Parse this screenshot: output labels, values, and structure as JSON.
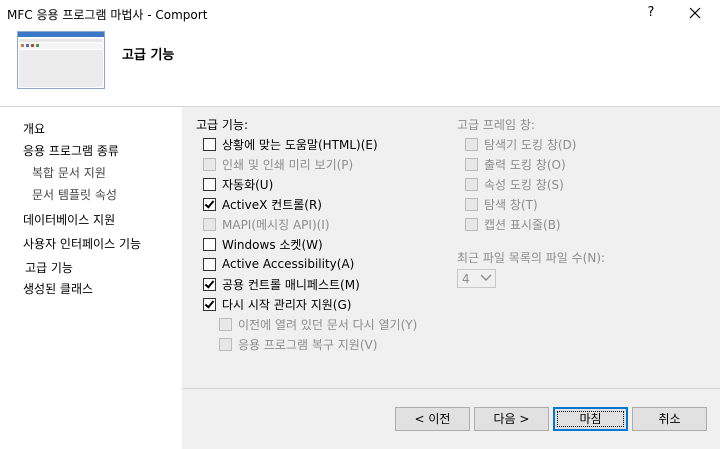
{
  "window": {
    "title": "MFC 응용 프로그램 마법사 - Comport",
    "help_glyph": "?"
  },
  "header": {
    "page_title": "고급 기능"
  },
  "nav": {
    "items": [
      {
        "label": "개요"
      },
      {
        "label": "응용 프로그램 종류"
      },
      {
        "label": "복합 문서 지원"
      },
      {
        "label": "문서 템플릿 속성"
      },
      {
        "label": "데이터베이스 지원"
      },
      {
        "label": "사용자 인터페이스 기능"
      },
      {
        "label": "고급 기능"
      },
      {
        "label": "생성된 클래스"
      }
    ]
  },
  "advanced": {
    "label": "고급 기능:",
    "options": [
      {
        "label": "상황에 맞는 도움말(HTML)(E)",
        "checked": false,
        "enabled": true
      },
      {
        "label": "인쇄 및 인쇄 미리 보기(P)",
        "checked": false,
        "enabled": false
      },
      {
        "label": "자동화(U)",
        "checked": false,
        "enabled": true
      },
      {
        "label": "ActiveX 컨트롤(R)",
        "checked": true,
        "enabled": true
      },
      {
        "label": "MAPI(메시징 API)(I)",
        "checked": false,
        "enabled": false
      },
      {
        "label": "Windows 소켓(W)",
        "checked": false,
        "enabled": true
      },
      {
        "label": "Active Accessibility(A)",
        "checked": false,
        "enabled": true
      },
      {
        "label": "공용 컨트롤 매니페스트(M)",
        "checked": true,
        "enabled": true
      },
      {
        "label": "다시 시작 관리자 지원(G)",
        "checked": true,
        "enabled": true
      },
      {
        "label": "이전에 열려 있던 문서 다시 열기(Y)",
        "checked": false,
        "enabled": false
      },
      {
        "label": "응용 프로그램 복구 지원(V)",
        "checked": false,
        "enabled": false
      }
    ]
  },
  "frame_panes": {
    "label": "고급 프레임 창:",
    "options": [
      {
        "label": "탐색기 도킹 창(D)",
        "checked": false,
        "enabled": false
      },
      {
        "label": "출력 도킹 창(O)",
        "checked": false,
        "enabled": false
      },
      {
        "label": "속성 도킹 창(S)",
        "checked": false,
        "enabled": false
      },
      {
        "label": "탐색 창(T)",
        "checked": false,
        "enabled": false
      },
      {
        "label": "캡션 표시줄(B)",
        "checked": false,
        "enabled": false
      }
    ]
  },
  "mru": {
    "label": "최근 파일 목록의 파일 수(N):",
    "value": "4"
  },
  "buttons": {
    "prev": "< 이전",
    "next": "다음 >",
    "finish": "마침",
    "cancel": "취소"
  }
}
